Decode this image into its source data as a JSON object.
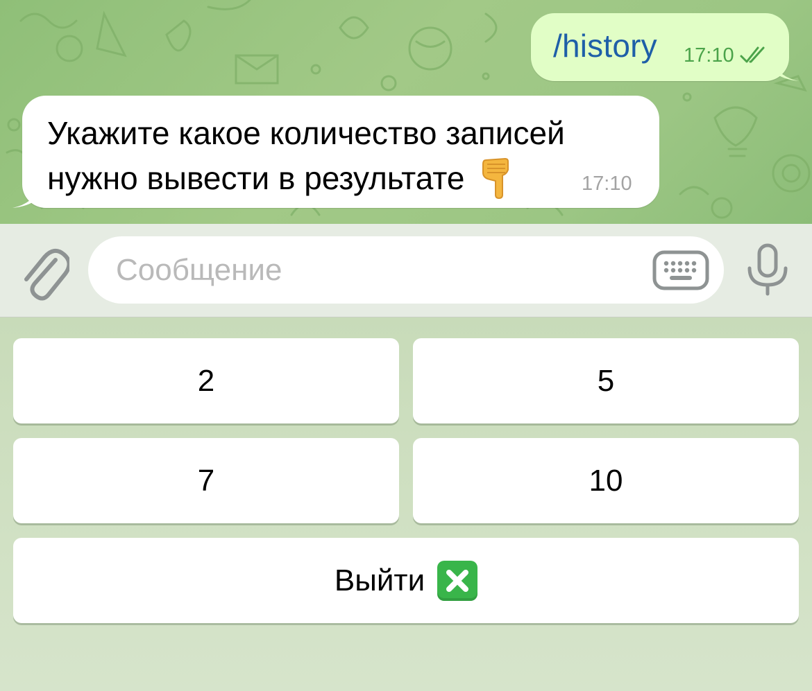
{
  "chat": {
    "outgoing": {
      "text": "/history",
      "time": "17:10",
      "status_icon": "double-check-icon",
      "color": "#e1fec6"
    },
    "incoming": {
      "text_line1": "Укажите какое количество записей",
      "text_line2": "нужно вывести в результате",
      "emoji": "pointing-down-icon",
      "time": "17:10"
    }
  },
  "input": {
    "placeholder": "Сообщение",
    "value": ""
  },
  "keyboard": {
    "buttons": [
      "2",
      "5",
      "7",
      "10"
    ],
    "exit_label": "Выйти",
    "exit_emoji": "cross-mark-icon"
  },
  "colors": {
    "chat_bg": "#9cc684",
    "link": "#1e5fa8",
    "time_out": "#4ba34a",
    "time_in": "#a3a3a3",
    "cross": "#39b54a"
  }
}
